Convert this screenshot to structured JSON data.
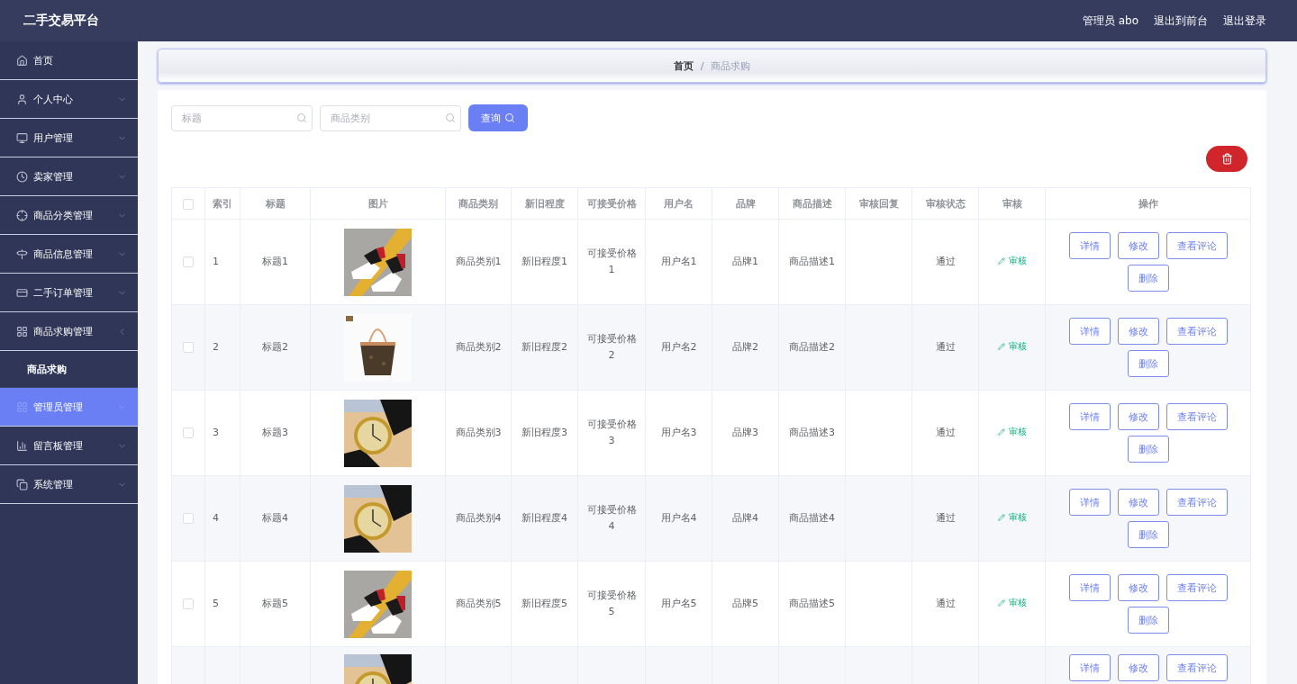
{
  "header": {
    "title": "二手交易平台",
    "user": "管理员 abo",
    "links": [
      "退出到前台",
      "退出登录"
    ]
  },
  "sidebar": {
    "items": [
      {
        "label": "首页",
        "selected": false
      },
      {
        "label": "个人中心",
        "selected": false,
        "expanded": false
      },
      {
        "label": "用户管理",
        "selected": false,
        "expanded": false
      },
      {
        "label": "卖家管理",
        "selected": false,
        "expanded": false
      },
      {
        "label": "商品分类管理",
        "selected": false,
        "expanded": false
      },
      {
        "label": "商品信息管理",
        "selected": false,
        "expanded": false
      },
      {
        "label": "二手订单管理",
        "selected": false,
        "expanded": false
      },
      {
        "label": "商品求购管理",
        "selected": false,
        "expanded": true,
        "children": [
          {
            "label": "商品求购",
            "selected": false
          }
        ]
      },
      {
        "label": "管理员管理",
        "selected": true,
        "expanded": false
      },
      {
        "label": "留言板管理",
        "selected": false,
        "expanded": false
      },
      {
        "label": "系统管理",
        "selected": false,
        "expanded": false
      }
    ]
  },
  "breadcrumb": {
    "items": [
      "首页",
      "商品求购"
    ],
    "separator": "/"
  },
  "search": {
    "fields": [
      {
        "placeholder": "标题"
      },
      {
        "placeholder": "商品类别"
      }
    ],
    "button": "查询"
  },
  "table": {
    "select_all_checked": false,
    "columns": [
      "索引",
      "标题",
      "图片",
      "商品类别",
      "新旧程度",
      "可接受价格",
      "用户名",
      "品牌",
      "商品描述",
      "审核回复",
      "审核状态",
      "审核",
      "操作"
    ],
    "rows": [
      {
        "kind": "full",
        "checked": false,
        "index": "1",
        "title": "标题1",
        "image": {
          "kind": "picture"
        },
        "category": "商品类别1",
        "condition": "新旧程度1",
        "price": "可接受价格1",
        "username": "用户名1",
        "brand": "品牌1",
        "description": "商品描述1",
        "status": "通过",
        "review": "审核",
        "actions": [
          "详情",
          "修改",
          "查看评论",
          "删除"
        ]
      },
      {
        "kind": "full",
        "checked": false,
        "index": "2",
        "title": "标题2",
        "image": {
          "kind": "picture"
        },
        "category": "商品类别2",
        "condition": "新旧程度2",
        "price": "可接受价格2",
        "username": "用户名2",
        "brand": "品牌2",
        "description": "商品描述2",
        "status": "通过",
        "review": "审核",
        "actions": [
          "详情",
          "修改",
          "查看评论",
          "删除"
        ]
      },
      {
        "kind": "full",
        "checked": false,
        "index": "3",
        "title": "标题3",
        "image": {
          "kind": "picture"
        },
        "category": "商品类别3",
        "condition": "新旧程度3",
        "price": "可接受价格3",
        "username": "用户名3",
        "brand": "品牌3",
        "description": "商品描述3",
        "status": "通过",
        "review": "审核",
        "actions": [
          "详情",
          "修改",
          "查看评论",
          "删除"
        ]
      },
      {
        "kind": "full",
        "checked": false,
        "index": "4",
        "title": "标题4",
        "image": {
          "kind": "picture"
        },
        "category": "商品类别4",
        "condition": "新旧程度4",
        "price": "可接受价格4",
        "username": "用户名4",
        "brand": "品牌4",
        "description": "商品描述4",
        "status": "通过",
        "review": "审核",
        "actions": [
          "详情",
          "修改",
          "查看评论",
          "删除"
        ]
      },
      {
        "kind": "full",
        "checked": false,
        "index": "5",
        "title": "标题5",
        "image": {
          "kind": "picture"
        },
        "category": "商品类别5",
        "condition": "新旧程度5",
        "price": "可接受价格5",
        "username": "用户名5",
        "brand": "品牌5",
        "description": "商品描述5",
        "status": "通过",
        "review": "审核",
        "actions": [
          "详情",
          "修改",
          "查看评论",
          "删除"
        ]
      },
      {
        "kind": "partial",
        "image": {
          "kind": "picture"
        },
        "actions": [
          "详情",
          "修改",
          "查看评论"
        ]
      }
    ]
  }
}
